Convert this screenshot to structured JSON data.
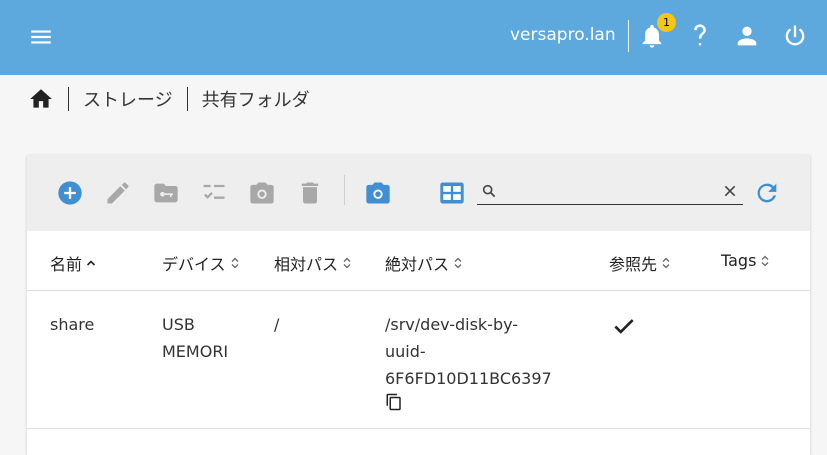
{
  "header": {
    "hostname": "versapro.lan",
    "notification_count": "1",
    "icons": [
      "menu-icon",
      "bell-icon",
      "help-icon",
      "user-icon",
      "power-icon"
    ]
  },
  "breadcrumb": {
    "items": [
      "ストレージ",
      "共有フォルダ"
    ]
  },
  "toolbar": {
    "search": {
      "value": "",
      "placeholder": ""
    },
    "tools": [
      "add-circle-icon",
      "edit-icon",
      "folder-key-icon",
      "checklist-icon",
      "camera-icon",
      "delete-icon",
      "camera-icon",
      "grid-view-icon",
      "refresh-icon"
    ],
    "colors": {
      "active": "#3f8fd2",
      "disabled": "#a8a8a8"
    }
  },
  "table": {
    "columns": [
      "名前",
      "デバイス",
      "相対パス",
      "絶対パス",
      "参照先",
      "Tags"
    ],
    "rows": [
      {
        "name": "share",
        "device_line1": "USB",
        "device_line2": "MEMORI",
        "relative_path": "/",
        "absolute_line1": "/srv/dev-disk-by-",
        "absolute_line2": "uuid-",
        "absolute_line3": "6F6FD10D11BC6397",
        "referenced": true,
        "tags": ""
      }
    ]
  }
}
